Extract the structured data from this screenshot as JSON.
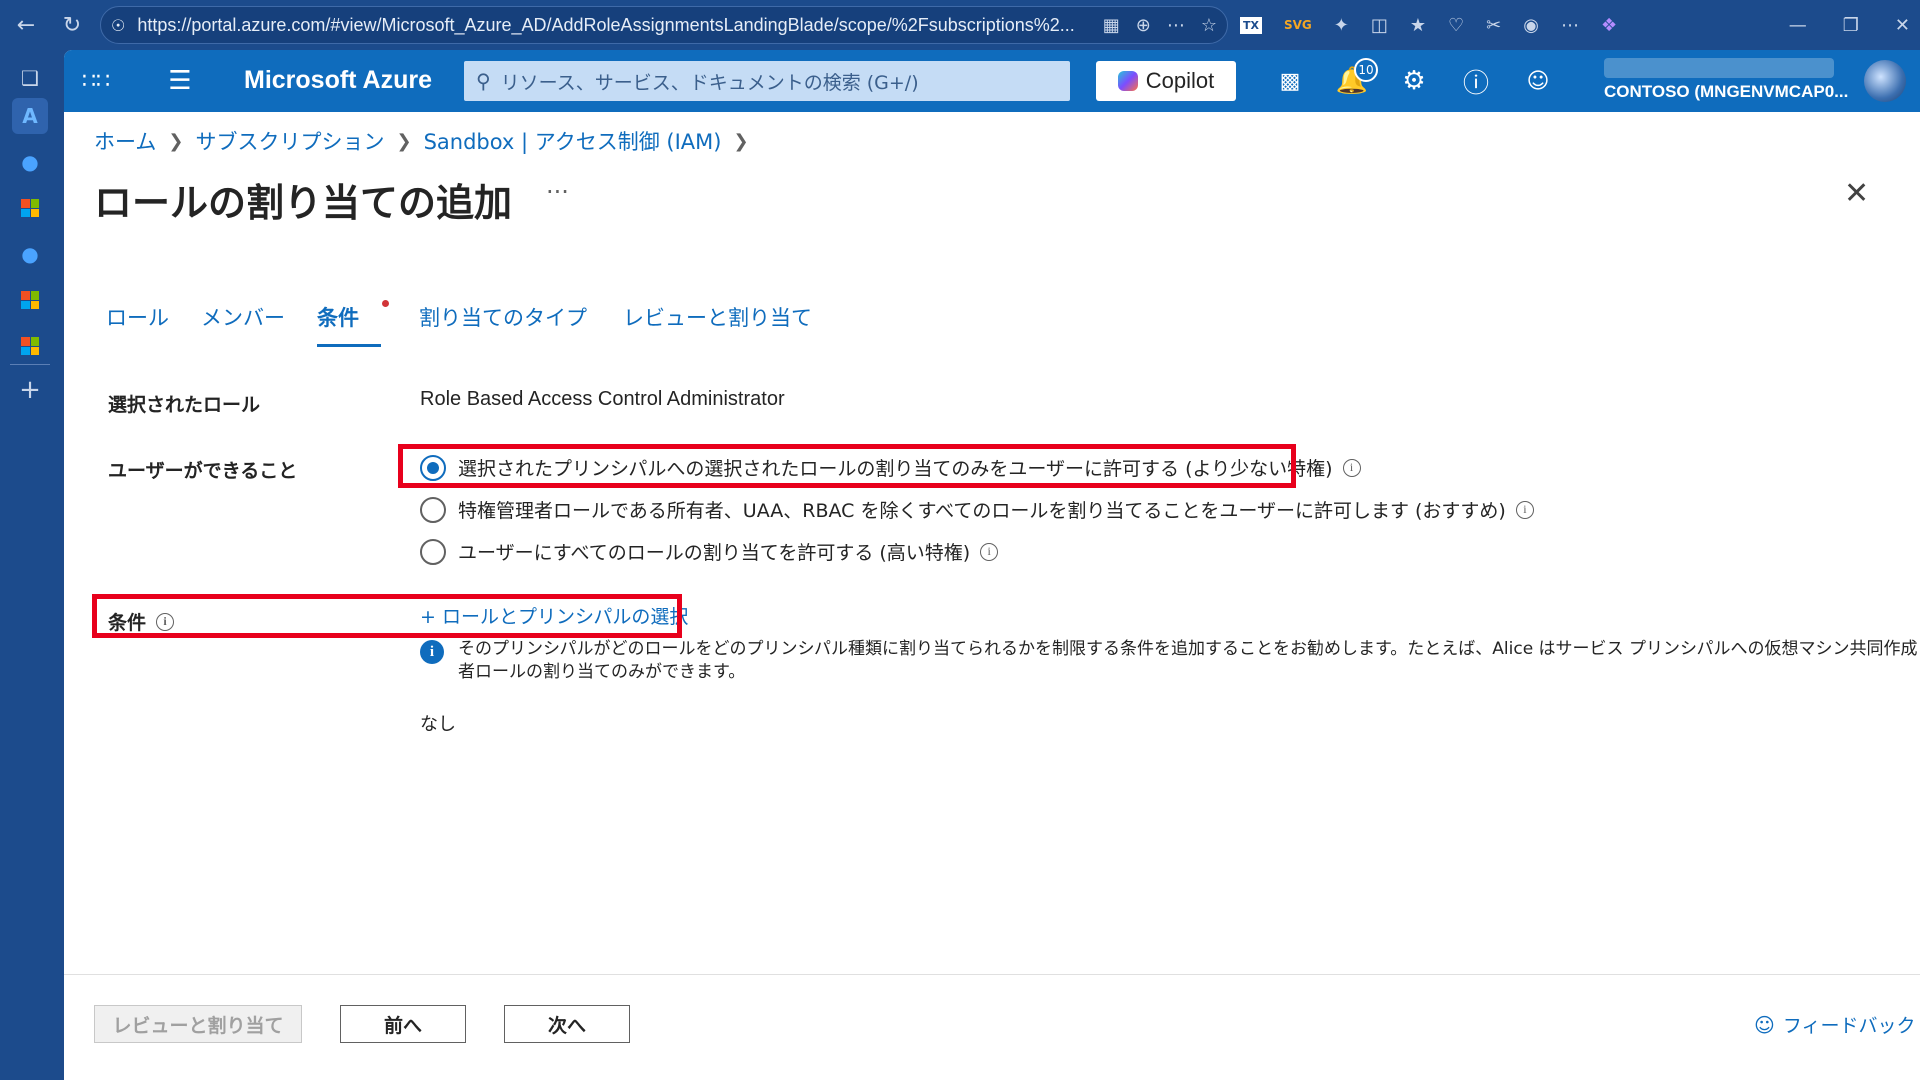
{
  "browser": {
    "url": "https://portal.azure.com/#view/Microsoft_Azure_AD/AddRoleAssignmentsLandingBlade/scope/%2Fsubscriptions%2..."
  },
  "portal": {
    "brand": "Microsoft Azure",
    "search_placeholder": "リソース、サービス、ドキュメントの検索 (G+/)",
    "copilot_label": "Copilot",
    "notifications_count": "10",
    "tenant": "CONTOSO (MNGENVMCAP0..."
  },
  "breadcrumb": {
    "items": [
      "ホーム",
      "サブスクリプション",
      "Sandbox | アクセス制御 (IAM)"
    ]
  },
  "page": {
    "title": "ロールの割り当ての追加",
    "more": "···"
  },
  "tabs": [
    {
      "label": "ロール"
    },
    {
      "label": "メンバー"
    },
    {
      "label": "条件"
    },
    {
      "label": "割り当てのタイプ"
    },
    {
      "label": "レビューと割り当て"
    }
  ],
  "form": {
    "selected_role_label": "選択されたロール",
    "selected_role_value": "Role Based Access Control Administrator",
    "user_can_label": "ユーザーができること",
    "options": [
      {
        "label": "選択されたプリンシパルへの選択されたロールの割り当てのみをユーザーに許可する (より少ない特権)",
        "checked": true
      },
      {
        "label": "特権管理者ロールである所有者、UAA、RBAC を除くすべてのロールを割り当てることをユーザーに許可します (おすすめ)",
        "checked": false
      },
      {
        "label": "ユーザーにすべてのロールの割り当てを許可する (高い特権)",
        "checked": false
      }
    ],
    "conditions_label": "条件",
    "add_link": "+ ロールとプリンシパルの選択",
    "info_text": "そのプリンシパルがどのロールをどのプリンシパル種類に割り当てられるかを制限する条件を追加することをお勧めします。たとえば、Alice はサービス プリンシパルへの仮想マシン共同作成者ロールの割り当てのみができます。",
    "none_text": "なし"
  },
  "footer": {
    "review_assign": "レビューと割り当て",
    "prev": "前へ",
    "next": "次へ",
    "feedback": "フィードバック"
  },
  "colors": {
    "azure_blue": "#0f6cbd",
    "highlight_red": "#e8001c",
    "browser_bar": "#1c4b8c"
  }
}
